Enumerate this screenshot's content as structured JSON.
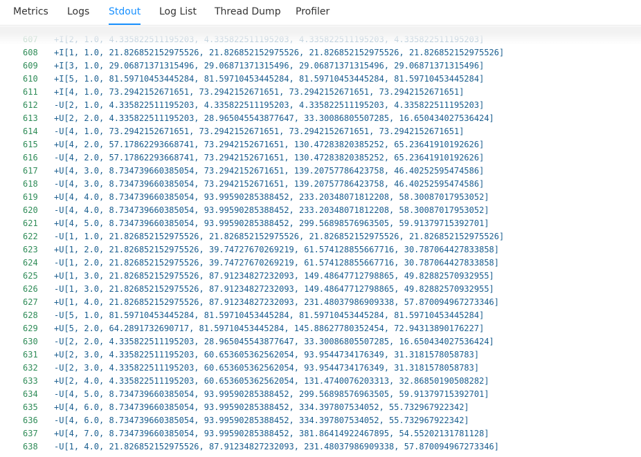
{
  "tabs": [
    {
      "label": "Metrics"
    },
    {
      "label": "Logs"
    },
    {
      "label": "Stdout",
      "active": true
    },
    {
      "label": "Log List"
    },
    {
      "label": "Thread Dump"
    },
    {
      "label": "Profiler"
    }
  ],
  "colors": {
    "accent": "#1890ff",
    "line_number": "#2e8b57",
    "line_text": "#1a5e8f"
  },
  "stdout": {
    "lines": [
      {
        "num": "607",
        "text": "+I[2, 1.0, 4.335822511195203, 4.335822511195203, 4.335822511195203, 4.335822511195203]"
      },
      {
        "num": "608",
        "text": "+I[1, 1.0, 21.826852152975526, 21.826852152975526, 21.826852152975526, 21.826852152975526]"
      },
      {
        "num": "609",
        "text": "+I[3, 1.0, 29.06871371315496, 29.06871371315496, 29.06871371315496, 29.06871371315496]"
      },
      {
        "num": "610",
        "text": "+I[5, 1.0, 81.59710453445284, 81.59710453445284, 81.59710453445284, 81.59710453445284]"
      },
      {
        "num": "611",
        "text": "+I[4, 1.0, 73.2942152671651, 73.2942152671651, 73.2942152671651, 73.2942152671651]"
      },
      {
        "num": "612",
        "text": "-U[2, 1.0, 4.335822511195203, 4.335822511195203, 4.335822511195203, 4.335822511195203]"
      },
      {
        "num": "613",
        "text": "+U[2, 2.0, 4.335822511195203, 28.965045543877647, 33.30086805507285, 16.650434027536424]"
      },
      {
        "num": "614",
        "text": "-U[4, 1.0, 73.2942152671651, 73.2942152671651, 73.2942152671651, 73.2942152671651]"
      },
      {
        "num": "615",
        "text": "+U[4, 2.0, 57.17862293668741, 73.2942152671651, 130.47283820385252, 65.23641910192626]"
      },
      {
        "num": "616",
        "text": "-U[4, 2.0, 57.17862293668741, 73.2942152671651, 130.47283820385252, 65.23641910192626]"
      },
      {
        "num": "617",
        "text": "+U[4, 3.0, 8.734739660385054, 73.2942152671651, 139.20757786423758, 46.40252595474586]"
      },
      {
        "num": "618",
        "text": "-U[4, 3.0, 8.734739660385054, 73.2942152671651, 139.20757786423758, 46.40252595474586]"
      },
      {
        "num": "619",
        "text": "+U[4, 4.0, 8.734739660385054, 93.99590285388452, 233.20348071812208, 58.30087017953052]"
      },
      {
        "num": "620",
        "text": "-U[4, 4.0, 8.734739660385054, 93.99590285388452, 233.20348071812208, 58.30087017953052]"
      },
      {
        "num": "621",
        "text": "+U[4, 5.0, 8.734739660385054, 93.99590285388452, 299.56898576963505, 59.91379715392701]"
      },
      {
        "num": "622",
        "text": "-U[1, 1.0, 21.826852152975526, 21.826852152975526, 21.826852152975526, 21.826852152975526]"
      },
      {
        "num": "623",
        "text": "+U[1, 2.0, 21.826852152975526, 39.74727670269219, 61.574128855667716, 30.787064427833858]"
      },
      {
        "num": "624",
        "text": "-U[1, 2.0, 21.826852152975526, 39.74727670269219, 61.574128855667716, 30.787064427833858]"
      },
      {
        "num": "625",
        "text": "+U[1, 3.0, 21.826852152975526, 87.91234827232093, 149.48647712798865, 49.82882570932955]"
      },
      {
        "num": "626",
        "text": "-U[1, 3.0, 21.826852152975526, 87.91234827232093, 149.48647712798865, 49.82882570932955]"
      },
      {
        "num": "627",
        "text": "+U[1, 4.0, 21.826852152975526, 87.91234827232093, 231.48037986909338, 57.870094967273346]"
      },
      {
        "num": "628",
        "text": "-U[5, 1.0, 81.59710453445284, 81.59710453445284, 81.59710453445284, 81.59710453445284]"
      },
      {
        "num": "629",
        "text": "+U[5, 2.0, 64.2891732690717, 81.59710453445284, 145.88627780352454, 72.94313890176227]"
      },
      {
        "num": "630",
        "text": "-U[2, 2.0, 4.335822511195203, 28.965045543877647, 33.30086805507285, 16.650434027536424]"
      },
      {
        "num": "631",
        "text": "+U[2, 3.0, 4.335822511195203, 60.653605362562054, 93.9544734176349, 31.3181578058783]"
      },
      {
        "num": "632",
        "text": "-U[2, 3.0, 4.335822511195203, 60.653605362562054, 93.9544734176349, 31.3181578058783]"
      },
      {
        "num": "633",
        "text": "+U[2, 4.0, 4.335822511195203, 60.653605362562054, 131.4740076203313, 32.86850190508282]"
      },
      {
        "num": "634",
        "text": "-U[4, 5.0, 8.734739660385054, 93.99590285388452, 299.56898576963505, 59.91379715392701]"
      },
      {
        "num": "635",
        "text": "+U[4, 6.0, 8.734739660385054, 93.99590285388452, 334.397807534052, 55.732967922342]"
      },
      {
        "num": "636",
        "text": "-U[4, 6.0, 8.734739660385054, 93.99590285388452, 334.397807534052, 55.732967922342]"
      },
      {
        "num": "637",
        "text": "+U[4, 7.0, 8.734739660385054, 93.99590285388452, 381.86414922467895, 54.55202131781128]"
      },
      {
        "num": "638",
        "text": "-U[1, 4.0, 21.826852152975526, 87.91234827232093, 231.48037986909338, 57.870094967273346]"
      }
    ]
  }
}
